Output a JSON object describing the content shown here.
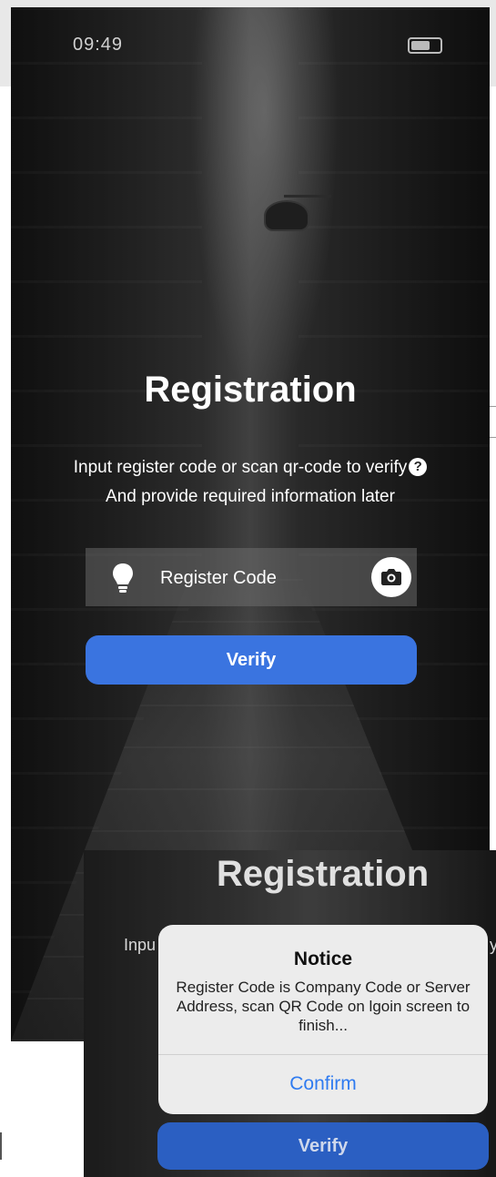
{
  "status_bar": {
    "time": "09:49"
  },
  "registration_screen": {
    "title": "Registration",
    "description_line1": "Input register code or scan qr-code to verify",
    "description_line2": "And provide required information later",
    "help_icon_glyph": "?",
    "register_code_placeholder": "Register Code",
    "verify_label": "Verify",
    "icons": {
      "code_field": "lightbulb-icon",
      "scan": "camera-icon",
      "help": "question-circle-icon"
    }
  },
  "notice_screen": {
    "title": "Registration",
    "partial_left_text": "Inpu",
    "partial_right_text": "y",
    "verify_label": "Verify",
    "dialog": {
      "title": "Notice",
      "message": "Register Code is Company Code or Server Address, scan QR Code on lgoin screen to finish...",
      "confirm_label": "Confirm"
    }
  },
  "colors": {
    "primary_button": "#3a74e0",
    "dialog_background": "#ececec",
    "confirm_text": "#2f7bf0"
  }
}
